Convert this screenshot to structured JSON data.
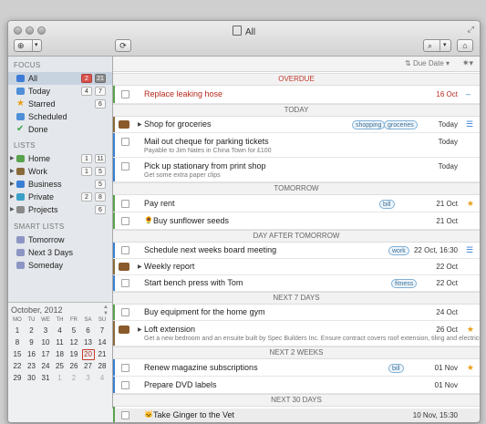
{
  "window": {
    "title": "All"
  },
  "sidebar": {
    "focus_header": "FOCUS",
    "focus": [
      {
        "label": "All",
        "b1": "2",
        "b2": "21",
        "color": "#3d7bd6"
      },
      {
        "label": "Today",
        "b1": "4",
        "b2": "7",
        "color": "#4e8fd8"
      },
      {
        "label": "Starred",
        "b1": "6",
        "b2": "",
        "color": "#e8a01a"
      },
      {
        "label": "Scheduled",
        "b1": "",
        "b2": "",
        "color": "#4e8fd8"
      },
      {
        "label": "Done",
        "b1": "",
        "b2": "",
        "color": "#3fa34d"
      }
    ],
    "lists_header": "LISTS",
    "lists": [
      {
        "label": "Home",
        "b1": "1",
        "b2": "11",
        "color": "#5aa34d"
      },
      {
        "label": "Work",
        "b1": "1",
        "b2": "5",
        "color": "#8a6a3a"
      },
      {
        "label": "Business",
        "b1": "",
        "b2": "5",
        "color": "#3a7fd5"
      },
      {
        "label": "Private",
        "b1": "2",
        "b2": "8",
        "color": "#3aa0c8"
      },
      {
        "label": "Projects",
        "b1": "",
        "b2": "6",
        "color": "#8a8a8a"
      }
    ],
    "smart_header": "SMART LISTS",
    "smart": [
      {
        "label": "Tomorrow"
      },
      {
        "label": "Next 3 Days"
      },
      {
        "label": "Someday"
      }
    ]
  },
  "calendar": {
    "month": "October, 2012",
    "headers": [
      "MO",
      "TU",
      "WE",
      "TH",
      "FR",
      "SA",
      "SU"
    ],
    "weeks": [
      [
        "1",
        "2",
        "3",
        "4",
        "5",
        "6",
        "7"
      ],
      [
        "8",
        "9",
        "10",
        "11",
        "12",
        "13",
        "14"
      ],
      [
        "15",
        "16",
        "17",
        "18",
        "19",
        "20",
        "21"
      ],
      [
        "22",
        "23",
        "24",
        "25",
        "26",
        "27",
        "28"
      ],
      [
        "29",
        "30",
        "31",
        "1",
        "2",
        "3",
        "4"
      ]
    ],
    "today": "20"
  },
  "main": {
    "sort": "Due Date",
    "groups": {
      "overdue": "OVERDUE",
      "today": "TODAY",
      "tomorrow": "TOMORROW",
      "dayafter": "DAY AFTER TOMORROW",
      "next7": "NEXT 7 DAYS",
      "next2w": "NEXT 2 WEEKS",
      "next30": "NEXT 30 DAYS"
    },
    "tasks": [
      {
        "title": "Replace leaking hose",
        "date": "16 Oct"
      },
      {
        "title": "Shop for groceries",
        "tags": [
          "shopping",
          "groceries"
        ],
        "date": "Today"
      },
      {
        "title": "Mail out cheque for parking tickets",
        "sub": "Payable to Jim Nates in China Town for £100",
        "date": "Today"
      },
      {
        "title": "Pick up stationary from print shop",
        "sub": "Get some extra paper clips",
        "date": "Today"
      },
      {
        "title": "Pay rent",
        "tags": [
          "bill"
        ],
        "date": "21 Oct"
      },
      {
        "title": "Buy sunflower seeds",
        "date": "21 Oct"
      },
      {
        "title": "Schedule next weeks board meeting",
        "tags": [
          "work"
        ],
        "date": "22 Oct, 16:30"
      },
      {
        "title": "Weekly report",
        "date": "22 Oct"
      },
      {
        "title": "Start bench press with Tom",
        "tags": [
          "fitness"
        ],
        "date": "22 Oct"
      },
      {
        "title": "Buy equipment for the home gym",
        "date": "24 Oct"
      },
      {
        "title": "Loft extension",
        "sub": "Get a new bedroom and an ensuite built by Spec Builders Inc. Ensure contract covers roof extension, tiling and electrics.",
        "date": "26 Oct"
      },
      {
        "title": "Renew magazine subscriptions",
        "tags": [
          "bill"
        ],
        "date": "01 Nov"
      },
      {
        "title": "Prepare DVD labels",
        "date": "01 Nov"
      },
      {
        "title": "Take Ginger to the Vet",
        "date": "10 Nov, 15:30"
      }
    ]
  },
  "colors": {
    "overdue": "#b5281d",
    "accent": "#3a7fd5",
    "star": "#e8a01a"
  }
}
